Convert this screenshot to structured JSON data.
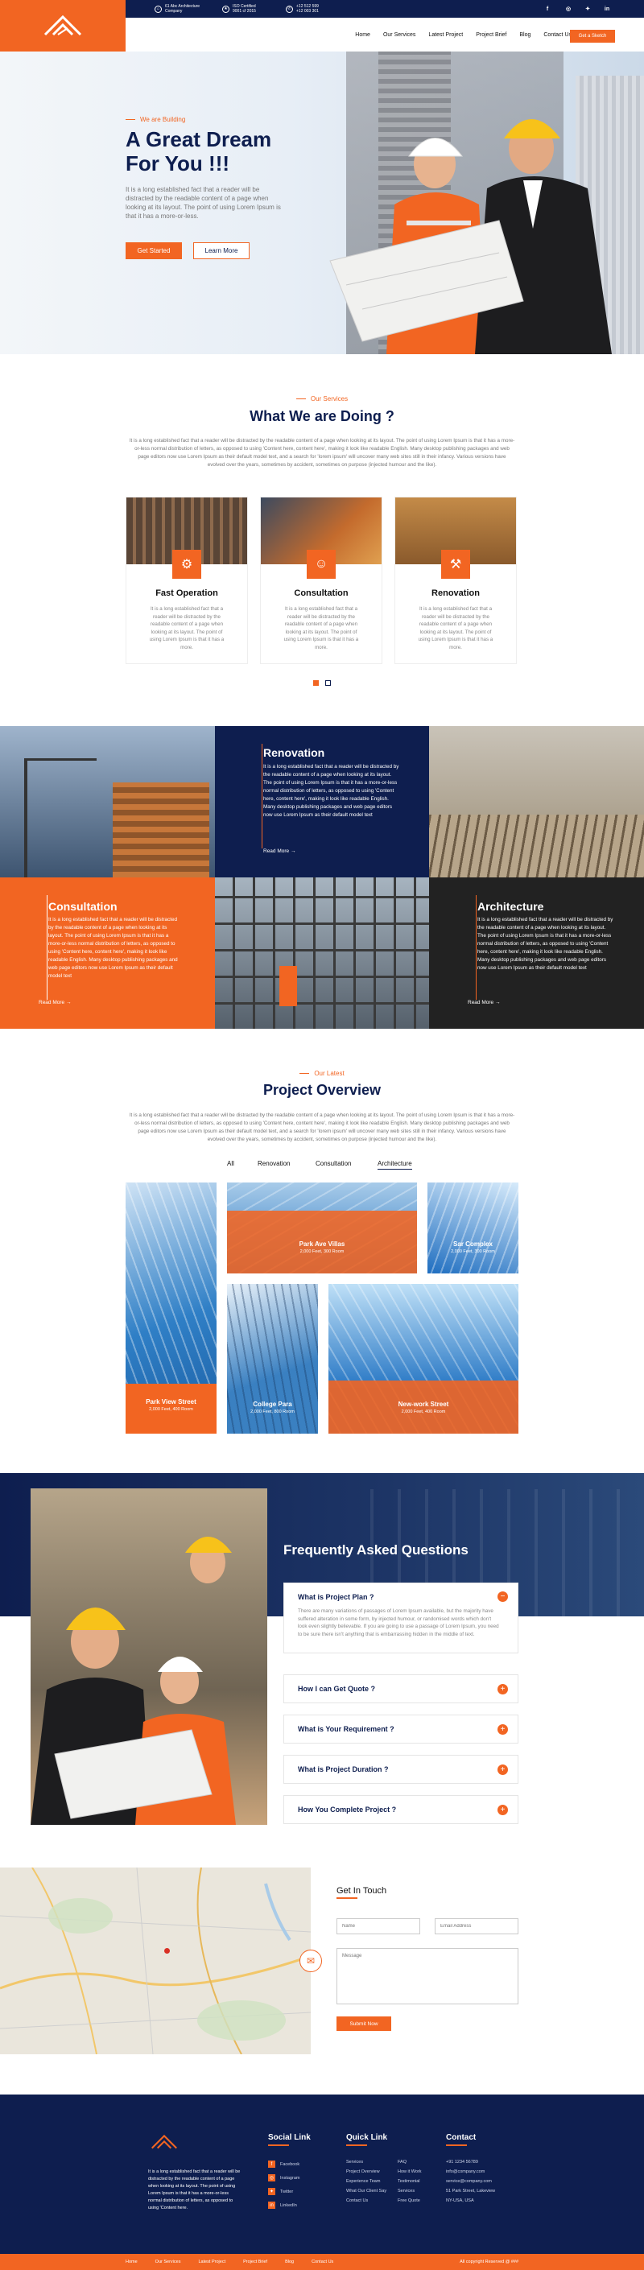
{
  "colors": {
    "accent": "#f26522",
    "navy": "#0e1e4f"
  },
  "topbar": {
    "items": [
      {
        "icon": "home-icon",
        "line1": "61 Abc Architecture",
        "line2": "Company"
      },
      {
        "icon": "award-icon",
        "line1": "ISO Certified",
        "line2": "9001 cf 2015"
      },
      {
        "icon": "phone-icon",
        "line1": "+12 512 599",
        "line2": "+12 003 301"
      }
    ],
    "socials": [
      "f",
      "ig",
      "t",
      "in"
    ]
  },
  "nav": {
    "links": [
      "Home",
      "Our Services",
      "Latest Project",
      "Project Brief",
      "Blog",
      "Contact Us"
    ],
    "cta": "Get a Sketch"
  },
  "hero": {
    "eyebrow": "We are Building",
    "title1": "A Great Dream",
    "title2": "For You !!!",
    "text": "It is a long established fact that a reader will be distracted by the readable content of a page when looking at its layout. The point of using Lorem Ipsum is that it has a more-or-less.",
    "btn_primary": "Get Started",
    "btn_secondary": "Learn More"
  },
  "services": {
    "eyebrow": "Our Services",
    "title": "What We are Doing ?",
    "text": "It is a long established fact that a reader will be distracted by the readable content of a page when looking at its layout. The point of using Lorem Ipsum is that it has a more-or-less normal distribution of letters, as opposed to using 'Content here, content here', making it look like readable English. Many desktop publishing packages and web page editors now use Lorem Ipsum as their default model text, and a search for 'lorem ipsum' will uncover many web sites still in their infancy. Various versions have evolved over the years, sometimes by accident, sometimes on purpose (injected humour and the like).",
    "cards": [
      {
        "title": "Fast Operation",
        "icon": "gear-icon",
        "text": "It is a long established fact that a reader will be distracted by the readable content of a page when looking at its layout. The point of using Lorem Ipsum is that it has a more."
      },
      {
        "title": "Consultation",
        "icon": "worker-icon",
        "text": "It is a long established fact that a reader will be distracted by the readable content of a page when looking at its layout. The point of using Lorem Ipsum is that it has a more."
      },
      {
        "title": "Renovation",
        "icon": "excavator-icon",
        "text": "It is a long established fact that a reader will be distracted by the readable content of a page when looking at its layout. The point of using Lorem Ipsum is that it has a more."
      }
    ]
  },
  "grid": {
    "renovation": {
      "title": "Renovation",
      "text": "It is a long established fact that a reader will be distracted by the readable content of a page when looking at its layout. The point of using Lorem Ipsum is that it has a more-or-less normal distribution of letters, as opposed to using 'Content here, content here', making it look like readable English. Many desktop publishing packages and web page editors now use Lorem Ipsum as their default model text",
      "link": "Read More"
    },
    "consultation": {
      "title": "Consultation",
      "text": "It is a long established fact that a reader will be distracted by the readable content of a page when looking at its layout. The point of using Lorem Ipsum is that it has a more-or-less normal distribution of letters, as opposed to using 'Content here, content here', making it look like readable English. Many desktop publishing packages and web page editors now use Lorem Ipsum as their default model text",
      "link": "Read More"
    },
    "architecture": {
      "title": "Architecture",
      "text": "It is a long established fact that a reader will be distracted by the readable content of a page when looking at its layout. The point of using Lorem Ipsum is that it has a more-or-less normal distribution of letters, as opposed to using 'Content here, content here', making it look like readable English. Many desktop publishing packages and web page editors now use Lorem Ipsum as their default model text",
      "link": "Read More"
    }
  },
  "projects": {
    "eyebrow": "Our Latest",
    "title": "Project Overview",
    "text": "It is a long established fact that a reader will be distracted by the readable content of a page when looking at its layout. The point of using Lorem Ipsum is that it has a more-or-less normal distribution of letters, as opposed to using 'Content here, content here', making it look like readable English. Many desktop publishing packages and web page editors now use Lorem Ipsum as their default model text, and a search for 'lorem ipsum' will uncover many web sites still in their infancy. Various versions have evolved over the years, sometimes by accident, sometimes on purpose (injected humour and the like).",
    "tabs": [
      "All",
      "Renovation",
      "Consultation",
      "Architecture"
    ],
    "active_tab": "Architecture",
    "items": [
      {
        "name": "Park Ave Villas",
        "meta": "2,000 Feet, 300 Room"
      },
      {
        "name": "Sar Complex",
        "meta": "2,000 Feet, 300 Room"
      },
      {
        "name": "Park View Street",
        "meta": "2,000 Feet, 400 Room"
      },
      {
        "name": "College Para",
        "meta": "2,000 Feet, 800 Room"
      },
      {
        "name": "New-work Street",
        "meta": "2,000 Feet, 400 Room"
      }
    ]
  },
  "faq": {
    "title": "Frequently Asked Questions",
    "items": [
      {
        "q": "What is Project Plan ?",
        "a": "There are many variations of passages of Lorem Ipsum available, but the majority have suffered alteration in some form, by injected humour, or randomised words which don't look even slightly believable. If you are going to use a passage of Lorem Ipsum, you need to be sure there isn't anything that is embarrassing hidden in the middle of text.",
        "open": true
      },
      {
        "q": "How I can Get Quote ?"
      },
      {
        "q": "What is Your Requirement ?"
      },
      {
        "q": "What is Project Duration ?"
      },
      {
        "q": "How You Complete Project ?"
      }
    ]
  },
  "contact": {
    "title": "Get In Touch",
    "name_ph": "Name",
    "email_ph": "Email Address",
    "message_ph": "Message",
    "submit": "Submit Now"
  },
  "footer": {
    "about": "It is a long established fact that a reader will be distracted by the readable content of a page when looking at its layout. The point of using Lorem Ipsum is that it has a more-or-less normal distribution of letters, as opposed to using 'Content here.",
    "social_title": "Social Link",
    "socials": [
      "Facebook",
      "Instagram",
      "Twitter",
      "LinkedIn"
    ],
    "quick_title": "Quick Link",
    "quick_col1": [
      "Services",
      "Project Overview",
      "Experience Team",
      "What Our Client Say",
      "Contact Us"
    ],
    "quick_col2": [
      "FAQ",
      "How it Work",
      "Testimonial",
      "Services",
      "Free Quote"
    ],
    "contact_title": "Contact",
    "contact_lines": [
      "+91 1234 56789",
      "info@company.com",
      "service@company.com",
      "51 Park Street, Lakeview",
      "NY-USA, USA"
    ],
    "bottom_links": [
      "Home",
      "Our Services",
      "Latest Project",
      "Project Brief",
      "Blog",
      "Contact Us"
    ],
    "copyright": "All copyright Reserved @ ###"
  }
}
